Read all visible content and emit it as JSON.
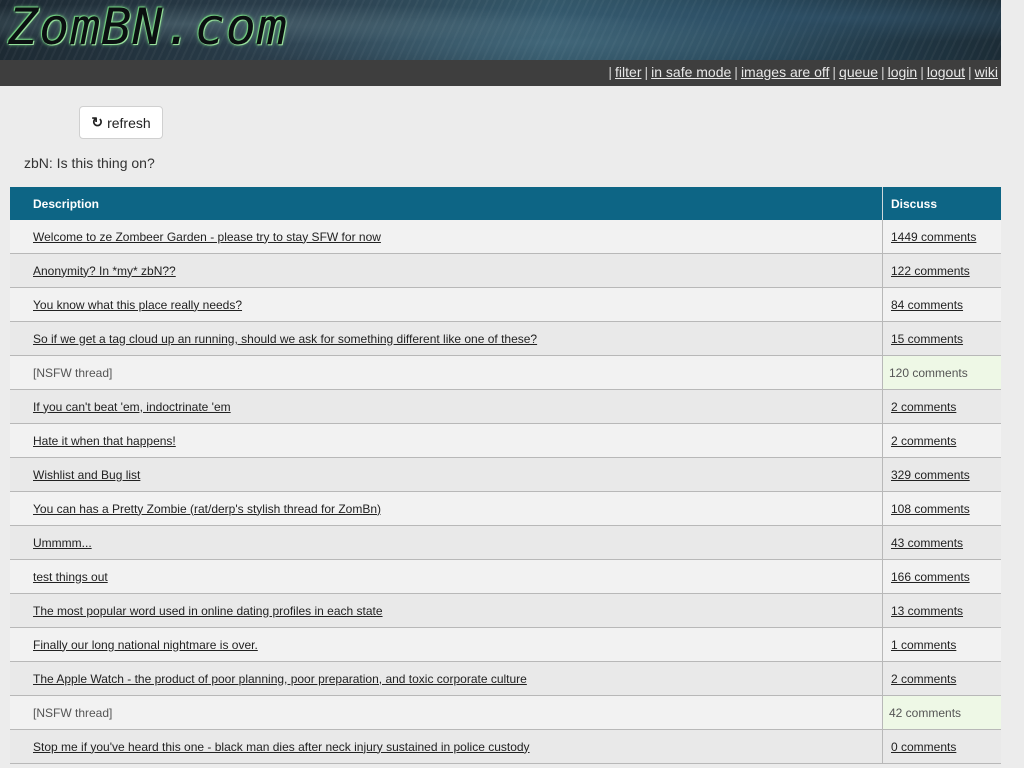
{
  "header": {
    "logo_text": "ZomBN.com",
    "nav_links": [
      "filter",
      "in safe mode",
      "images are off",
      "queue",
      "login",
      "logout",
      "wiki"
    ]
  },
  "toolbar": {
    "refresh_label": "refresh",
    "refresh_icon": "refresh-icon"
  },
  "site_message": "zbN: Is this thing on?",
  "table": {
    "columns": [
      "Description",
      "Discuss"
    ],
    "rows": [
      {
        "description": "Welcome to ze Zombeer Garden - please try to stay SFW for now",
        "comments": "1449 comments",
        "nsfw": false
      },
      {
        "description": "Anonymity? In *my* zbN??",
        "comments": "122 comments",
        "nsfw": false
      },
      {
        "description": "You know what this place really needs?",
        "comments": "84 comments",
        "nsfw": false
      },
      {
        "description": "So if we get a tag cloud up an running, should we ask for something different like one of these?",
        "comments": "15 comments",
        "nsfw": false
      },
      {
        "description": "[NSFW thread]",
        "comments": "120 comments",
        "nsfw": true
      },
      {
        "description": "If you can't beat 'em, indoctrinate 'em",
        "comments": "2 comments",
        "nsfw": false
      },
      {
        "description": "Hate it when that happens!",
        "comments": "2 comments",
        "nsfw": false
      },
      {
        "description": "Wishlist and Bug list",
        "comments": "329 comments",
        "nsfw": false
      },
      {
        "description": "You can has a Pretty Zombie (rat/derp's stylish thread for ZomBn)",
        "comments": "108 comments",
        "nsfw": false
      },
      {
        "description": "Ummmm...",
        "comments": "43 comments",
        "nsfw": false
      },
      {
        "description": "test things out",
        "comments": "166 comments",
        "nsfw": false
      },
      {
        "description": "The most popular word used in online dating profiles in each state",
        "comments": "13 comments",
        "nsfw": false
      },
      {
        "description": "Finally our long national nightmare is over.",
        "comments": "1 comments",
        "nsfw": false
      },
      {
        "description": "The Apple Watch - the product of poor planning, poor preparation, and toxic corporate culture",
        "comments": "2 comments",
        "nsfw": false
      },
      {
        "description": "[NSFW thread]",
        "comments": "42 comments",
        "nsfw": true
      },
      {
        "description": "Stop me if you've heard this one - black man dies after neck injury sustained in police custody",
        "comments": "0 comments",
        "nsfw": false
      }
    ]
  },
  "colors": {
    "header_bar": "#0d6585",
    "nav_bar": "#3e3e3e",
    "nsfw_highlight": "#eef8e6"
  }
}
